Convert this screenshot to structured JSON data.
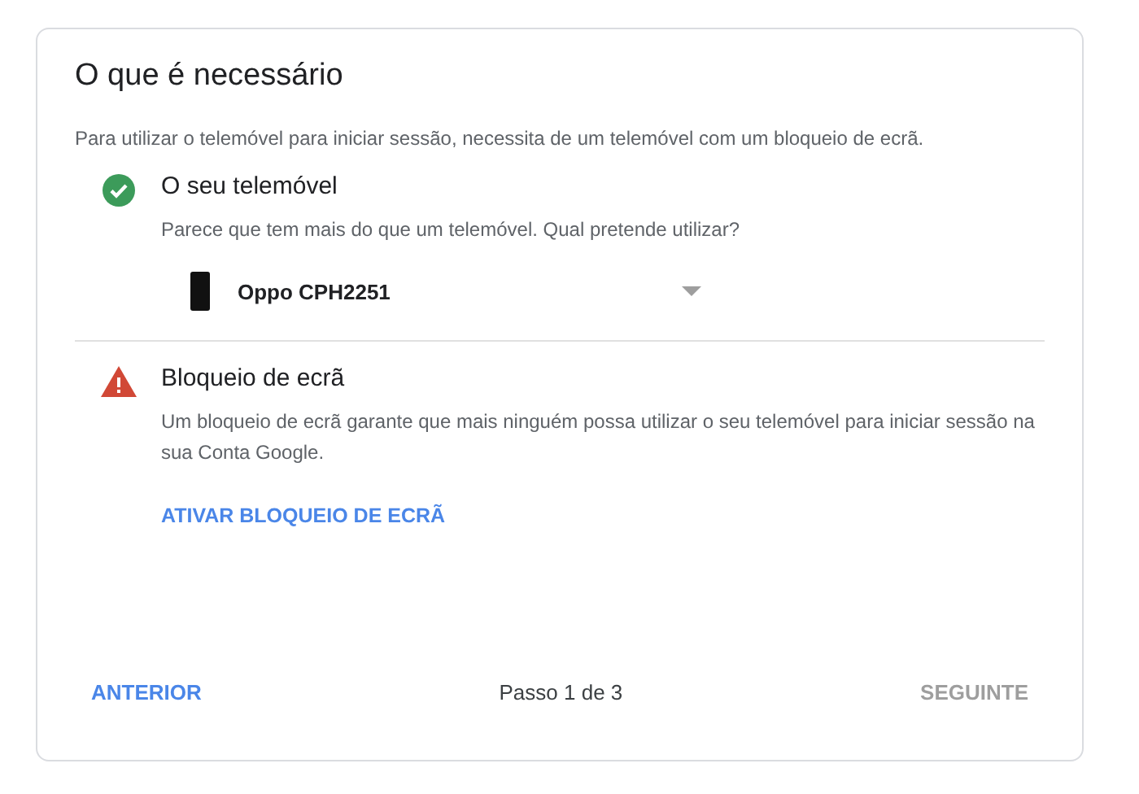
{
  "title": "O que é necessário",
  "intro": "Para utilizar o telemóvel para iniciar sessão, necessita de um telemóvel com um bloqueio de ecrã.",
  "requirements": [
    {
      "kind": "ok",
      "title": "O seu telemóvel",
      "description": "Parece que tem mais do que um telemóvel. Qual pretende utilizar?",
      "device_select": {
        "value": "Oppo CPH2251"
      }
    },
    {
      "kind": "warning",
      "title": "Bloqueio de ecrã",
      "description": "Um bloqueio de ecrã garante que mais ninguém possa utilizar o seu telemóvel para iniciar sessão na sua Conta Google.",
      "action": "ATIVAR BLOQUEIO DE ECRÃ"
    }
  ],
  "footer": {
    "back": {
      "label": "ANTERIOR",
      "disabled": false
    },
    "step": "Passo 1 de 3",
    "next": {
      "label": "SEGUINTE",
      "disabled": true
    }
  }
}
